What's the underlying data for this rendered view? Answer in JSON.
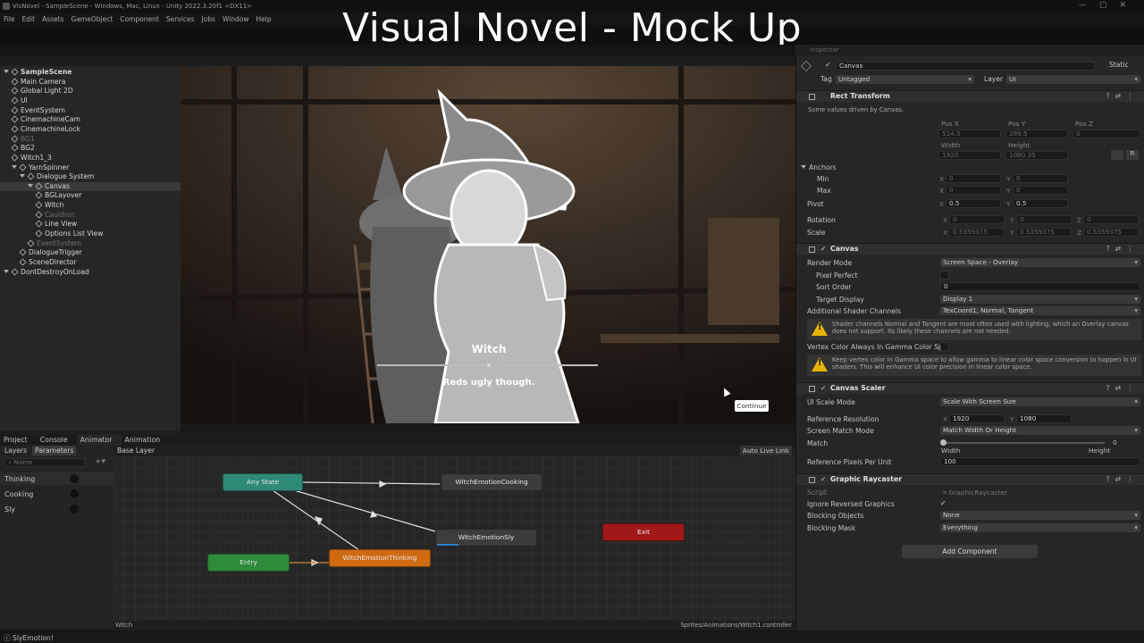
{
  "window": {
    "title": "VisNovel - SampleScene - Windows, Mac, Linux - Unity 2022.3.20f1 <DX11>"
  },
  "overlay_title": "Visual Novel - Mock Up",
  "menu": [
    "File",
    "Edit",
    "Assets",
    "GameObject",
    "Component",
    "Services",
    "Jobs",
    "Window",
    "Help"
  ],
  "hierarchy": {
    "items": [
      {
        "label": "SampleScene",
        "depth": 0,
        "dim": false
      },
      {
        "label": "Main Camera",
        "depth": 1,
        "dim": false
      },
      {
        "label": "Global Light 2D",
        "depth": 1,
        "dim": false
      },
      {
        "label": "UI",
        "depth": 1,
        "dim": false
      },
      {
        "label": "EventSystem",
        "depth": 1,
        "dim": false
      },
      {
        "label": "CinemachineCam",
        "depth": 1,
        "dim": false
      },
      {
        "label": "CinemachineLock",
        "depth": 1,
        "dim": false
      },
      {
        "label": "BG1",
        "depth": 1,
        "dim": true
      },
      {
        "label": "BG2",
        "depth": 1,
        "dim": false
      },
      {
        "label": "Witch1_3",
        "depth": 1,
        "dim": false
      },
      {
        "label": "YarnSpinner",
        "depth": 1,
        "dim": false
      },
      {
        "label": "Dialogue System",
        "depth": 2,
        "dim": false
      },
      {
        "label": "Canvas",
        "depth": 3,
        "dim": false
      },
      {
        "label": "BGLayover",
        "depth": 4,
        "dim": false
      },
      {
        "label": "Witch",
        "depth": 4,
        "dim": false
      },
      {
        "label": "Cauldron",
        "depth": 4,
        "dim": true
      },
      {
        "label": "Line View",
        "depth": 4,
        "dim": false
      },
      {
        "label": "Options List View",
        "depth": 4,
        "dim": false
      },
      {
        "label": "EventSystem",
        "depth": 3,
        "dim": true
      },
      {
        "label": "DialogueTrigger",
        "depth": 2,
        "dim": false
      },
      {
        "label": "SceneDirector",
        "depth": 2,
        "dim": false
      },
      {
        "label": "DontDestroyOnLoad",
        "depth": 0,
        "dim": false
      }
    ]
  },
  "game": {
    "speaker": "Witch",
    "line": "Reds ugly though.",
    "continue_label": "Continue"
  },
  "bottom_tabs": [
    "Project",
    "Console",
    "Animator",
    "Animation"
  ],
  "animator": {
    "layers_tab": "Layers",
    "parameters_tab": "Parameters",
    "search_placeholder": "Name",
    "base_layer": "Base Layer",
    "auto_live_link": "Auto Live Link",
    "parameters": [
      "Thinking",
      "Cooking",
      "Sly"
    ],
    "states": {
      "any": "Any State",
      "entry": "Entry",
      "exit": "Exit",
      "cooking": "WitchEmotionCooking",
      "sly": "WitchEmotionSly",
      "thinking": "WitchEmotionThinking"
    },
    "footer_left": "Witch",
    "footer_right": "Sprites/Animations/Witch1.controller"
  },
  "inspector": {
    "tab": "Inspector",
    "object_name": "Canvas",
    "static_label": "Static",
    "tag_label": "Tag",
    "tag_value": "Untagged",
    "layer_label": "Layer",
    "layer_value": "UI",
    "rect_transform": {
      "title": "Rect Transform",
      "note": "Some values driven by Canvas.",
      "pos_x_label": "Pos X",
      "pos_y_label": "Pos Y",
      "pos_z_label": "Pos Z",
      "pos_x": "514.5",
      "pos_y": "289.5",
      "pos_z": "0",
      "width_label": "Width",
      "height_label": "Height",
      "width": "1920",
      "height": "1080.35",
      "anchors": "Anchors",
      "min": "Min",
      "max": "Max",
      "min_x": "0",
      "min_y": "0",
      "max_x": "0",
      "max_y": "0",
      "pivot": "Pivot",
      "pivot_x": "0.5",
      "pivot_y": "0.5",
      "rotation": "Rotation",
      "rot_x": "0",
      "rot_y": "0",
      "rot_z": "0",
      "scale": "Scale",
      "scale_x": "0.5359375",
      "scale_y": "0.5359375",
      "scale_z": "0.5359375"
    },
    "canvas": {
      "title": "Canvas",
      "render_mode_label": "Render Mode",
      "render_mode": "Screen Space - Overlay",
      "pixel_perfect": "Pixel Perfect",
      "sort_order_label": "Sort Order",
      "sort_order": "0",
      "target_display_label": "Target Display",
      "target_display": "Display 1",
      "shader_channels_label": "Additional Shader Channels",
      "shader_channels": "TexCoord1, Normal, Tangent",
      "warn1": "Shader channels Normal and Tangent are most often used with lighting, which an Overlay canvas does not support. Its likely these channels are not needed.",
      "vertex_color_label": "Vertex Color Always In Gamma Color Sp",
      "warn2": "Keep vertex color in Gamma space to allow gamma to linear color space conversion to happen in UI shaders. This will enhance UI color precision in linear color space."
    },
    "scaler": {
      "title": "Canvas Scaler",
      "ui_scale_mode_label": "UI Scale Mode",
      "ui_scale_mode": "Scale With Screen Size",
      "ref_res_label": "Reference Resolution",
      "ref_x": "1920",
      "ref_y": "1080",
      "match_mode_label": "Screen Match Mode",
      "match_mode": "Match Width Or Height",
      "match_label": "Match",
      "match_value": "0",
      "width_label": "Width",
      "height_label": "Height",
      "ref_ppu_label": "Reference Pixels Per Unit",
      "ref_ppu": "100"
    },
    "raycaster": {
      "title": "Graphic Raycaster",
      "script_label": "Script",
      "script": "GraphicRaycaster",
      "ignore_reversed_label": "Ignore Reversed Graphics",
      "blocking_objects_label": "Blocking Objects",
      "blocking_objects": "None",
      "blocking_mask_label": "Blocking Mask",
      "blocking_mask": "Everything"
    },
    "add_component": "Add Component"
  },
  "status_text": "SlyEmotion!",
  "colors": {
    "any_state": "#2f8a77",
    "entry": "#2e8a3a",
    "exit": "#a01818",
    "thinking": "#d06a12",
    "default_state": "#3c3c3c"
  }
}
